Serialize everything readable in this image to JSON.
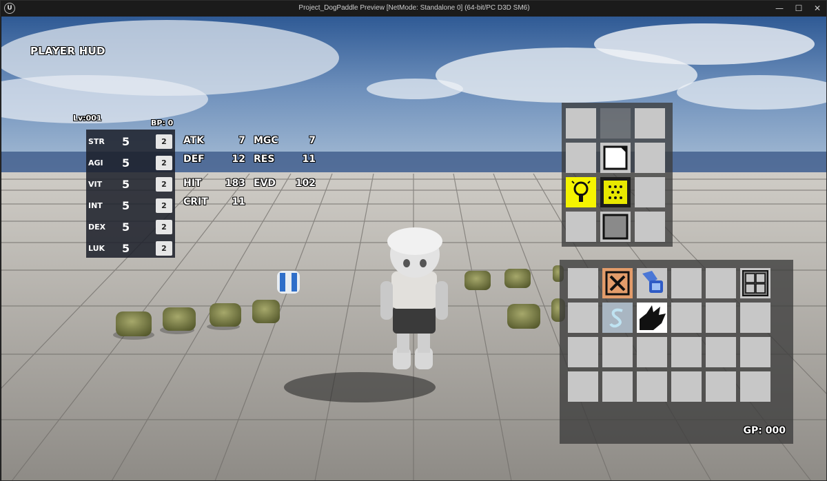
{
  "window": {
    "title": "Project_DogPaddle Preview [NetMode: Standalone 0]  (64-bit/PC D3D SM6)",
    "controls": {
      "minimize": "—",
      "maximize": "☐",
      "close": "✕"
    },
    "logo": "U"
  },
  "hud": {
    "title": "PLAYER HUD",
    "level": "Lv:001",
    "bp": "BP: 0",
    "stats": [
      {
        "name": "STR",
        "value": "5",
        "button": "2"
      },
      {
        "name": "AGI",
        "value": "5",
        "button": "2"
      },
      {
        "name": "VIT",
        "value": "5",
        "button": "2"
      },
      {
        "name": "INT",
        "value": "5",
        "button": "2"
      },
      {
        "name": "DEX",
        "value": "5",
        "button": "2"
      },
      {
        "name": "LUK",
        "value": "5",
        "button": "2"
      }
    ],
    "derived": [
      {
        "label": "ATK",
        "value": "7"
      },
      {
        "label": "MGC",
        "value": "7"
      },
      {
        "label": "DEF",
        "value": "12"
      },
      {
        "label": "RES",
        "value": "11"
      },
      {
        "label": "HIT",
        "value": "183"
      },
      {
        "label": "EVD",
        "value": "102"
      },
      {
        "label": "CRIT",
        "value": "11"
      }
    ],
    "equipment": {
      "slots": [
        {
          "item": null
        },
        {
          "item": null
        },
        {
          "item": null
        },
        {
          "item": null
        },
        {
          "item": "paper-sheet-icon"
        },
        {
          "item": null
        },
        {
          "item": "lightbulb-icon"
        },
        {
          "item": "dotted-block-icon"
        },
        {
          "item": null
        },
        {
          "item": null
        },
        {
          "item": "gray-block-icon"
        },
        {
          "item": null
        }
      ],
      "highlight_color": "#f5f400"
    },
    "inventory": {
      "columns": 6,
      "rows": 4,
      "items": {
        "0-1": "crossed-box-icon",
        "0-2": "blue-robot-icon",
        "0-5": "window-grid-icon",
        "1-1": "snake-s-icon",
        "1-2": "black-claw-icon"
      },
      "gp": "GP: 000"
    }
  }
}
